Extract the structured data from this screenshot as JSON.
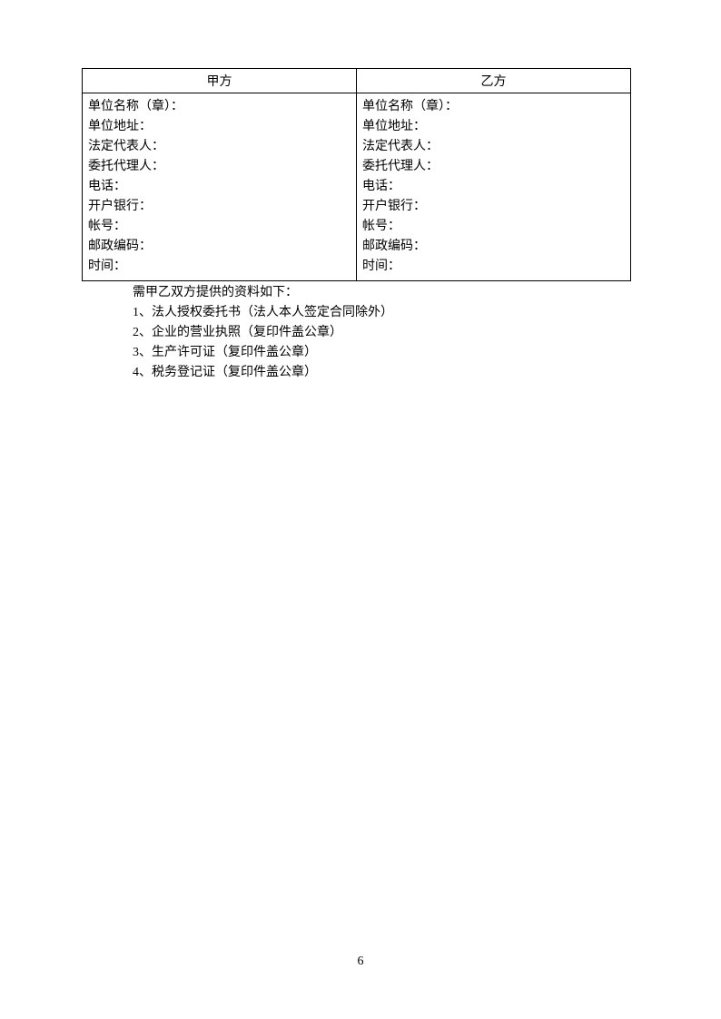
{
  "table": {
    "headers": {
      "party_a": "甲方",
      "party_b": "乙方"
    },
    "fields": [
      "单位名称（章）：",
      "单位地址：",
      "法定代表人：",
      "委托代理人：",
      "电话：",
      "开户银行：",
      "帐号：",
      "邮政编码：",
      "时间："
    ]
  },
  "materials": {
    "title": "需甲乙双方提供的资料如下：",
    "items": [
      "1、法人授权委托书（法人本人签定合同除外）",
      "2、企业的营业执照（复印件盖公章）",
      "3、生产许可证（复印件盖公章）",
      "4、税务登记证（复印件盖公章）"
    ]
  },
  "page_number": "6"
}
